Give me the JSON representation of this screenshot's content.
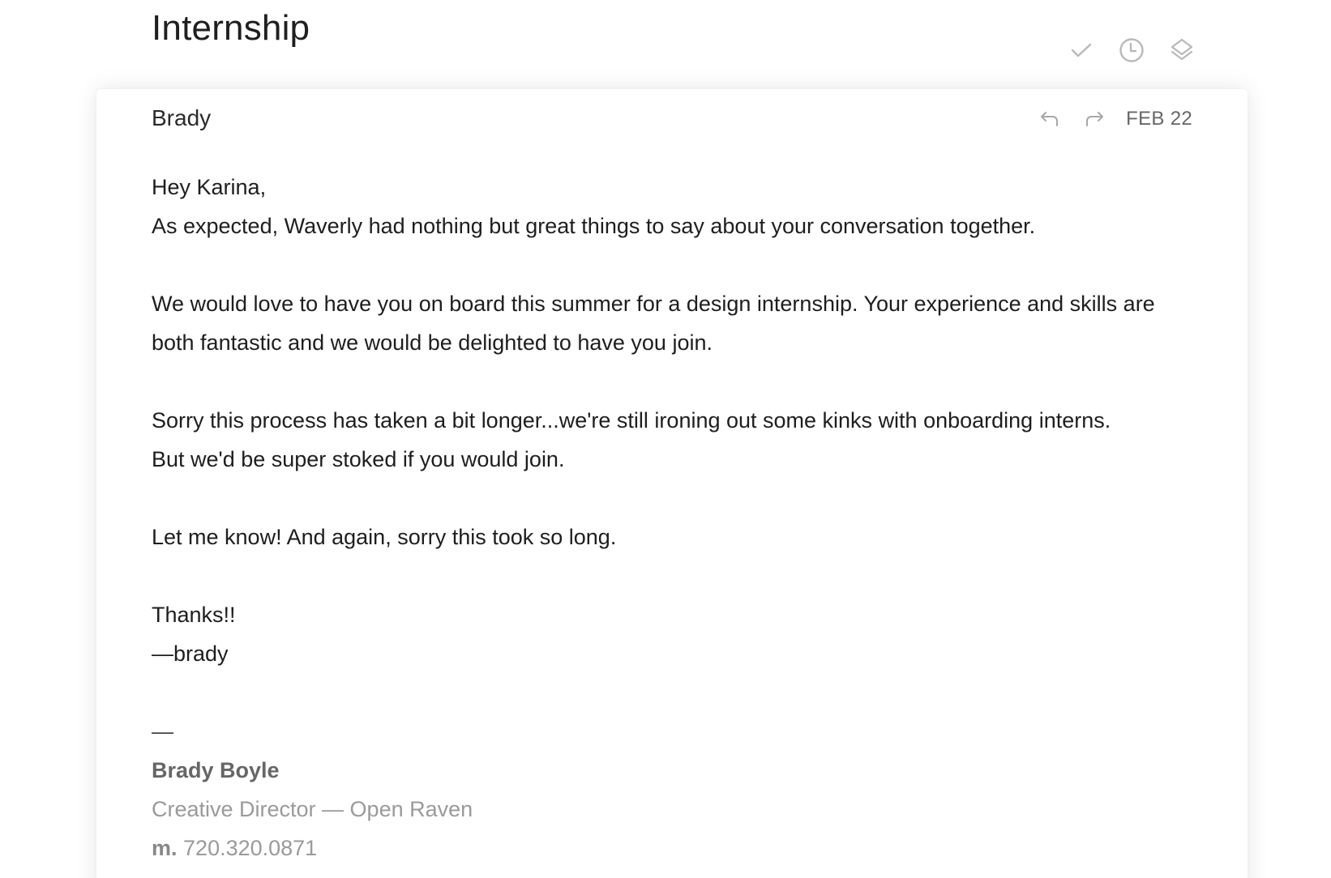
{
  "thread": {
    "title": "Internship"
  },
  "toolbar": {
    "icons": [
      "check-icon",
      "clock-icon",
      "layers-icon"
    ]
  },
  "message": {
    "sender": "Brady",
    "date": "FEB 22",
    "actions": [
      "reply-icon",
      "forward-icon"
    ],
    "body": {
      "greeting": "Hey Karina,",
      "p1": "As expected, Waverly had nothing but great things to say about your conversation together.",
      "p2_line1": "We would love to have you on board this summer for a design internship. Your experience and skills are",
      "p2_line2": "both fantastic and we would be delighted to have you join.",
      "p3_line1": "Sorry this process has taken a bit longer...we're still ironing out some kinks with onboarding interns.",
      "p3_line2": "But we'd be super stoked if you would join.",
      "p4": "Let me know! And again, sorry this took so long.",
      "closing": "Thanks!!",
      "signoff": "—brady"
    },
    "signature": {
      "dash": "—",
      "name": "Brady Boyle",
      "role": "Creative Director — Open Raven",
      "phone_label": "m.",
      "phone": "720.320.0871"
    }
  }
}
